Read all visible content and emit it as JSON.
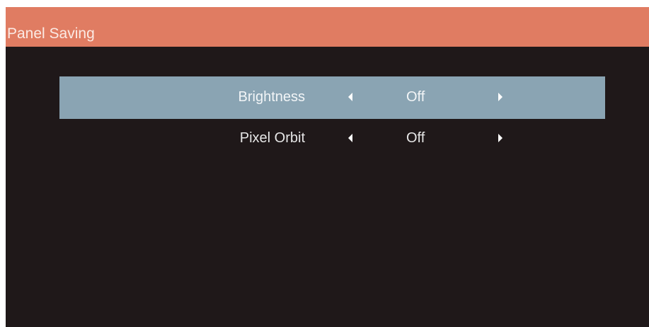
{
  "header": {
    "title": "Panel Saving"
  },
  "menu": {
    "items": [
      {
        "label": "Brightness",
        "value": "Off",
        "left_icon": "triangle-left-icon",
        "right_icon": "triangle-right-icon",
        "selected": true
      },
      {
        "label": "Pixel Orbit",
        "value": "Off",
        "left_icon": "triangle-left-icon",
        "right_icon": "triangle-right-icon",
        "selected": false
      }
    ]
  },
  "colors": {
    "header_background": "#e07c62",
    "panel_background": "#1f1819",
    "selection_highlight": "#8aa4b3",
    "text": "#e6e6e6"
  }
}
